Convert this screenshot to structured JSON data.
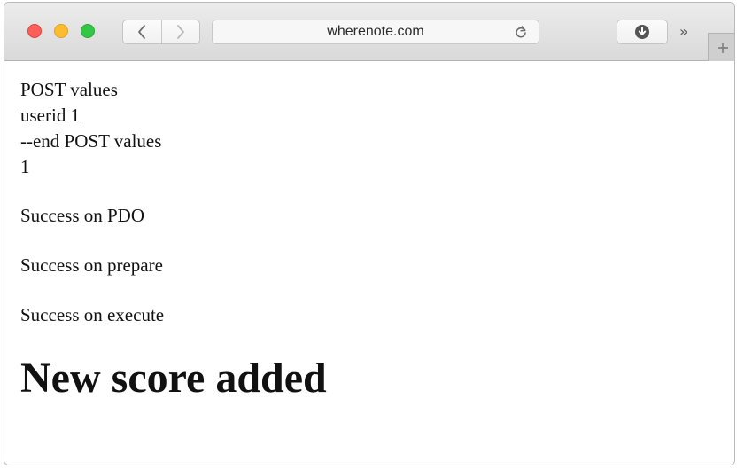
{
  "browser": {
    "url": "wherenote.com",
    "back_icon": "chevron-left-icon",
    "forward_icon": "chevron-right-icon",
    "reload_icon": "reload-icon",
    "download_icon": "download-icon",
    "overflow_label": "»",
    "new_tab_label": "+",
    "colors": {
      "close": "#fc5f57",
      "minimize": "#fdbc2e",
      "maximize": "#33c748"
    }
  },
  "page": {
    "lines": [
      "POST values",
      "userid 1",
      "--end POST values",
      "1",
      "Success on PDO",
      "Success on prepare",
      "Success on execute"
    ],
    "heading": "New score added"
  }
}
